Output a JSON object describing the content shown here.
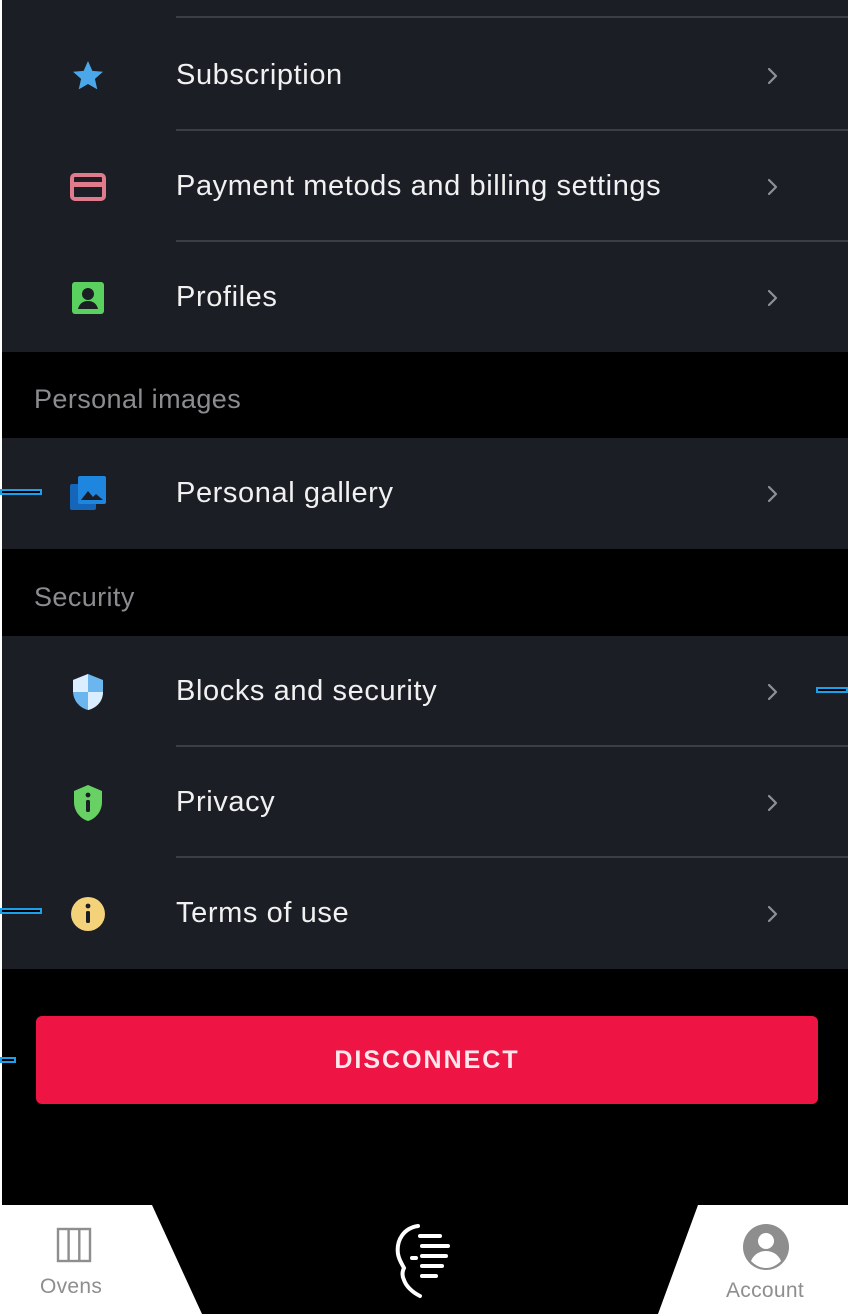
{
  "account_group": {
    "items": [
      {
        "label": "Subscription",
        "icon": "star-icon",
        "icon_color": "#4aa8ea"
      },
      {
        "label": "Payment metods and billing settings",
        "icon": "credit-card-icon",
        "icon_color": "#e07b8c"
      },
      {
        "label": "Profiles",
        "icon": "profile-badge-icon",
        "icon_color": "#5ad15f"
      }
    ]
  },
  "personal_images": {
    "header": "Personal images",
    "items": [
      {
        "label": "Personal gallery",
        "icon": "gallery-icon",
        "icon_color": "#1f86e0"
      }
    ]
  },
  "security": {
    "header": "Security",
    "items": [
      {
        "label": "Blocks and security",
        "icon": "shield-icon",
        "icon_color": "#6cb6ef"
      },
      {
        "label": "Privacy",
        "icon": "privacy-shield-icon",
        "icon_color": "#67d163"
      },
      {
        "label": "Terms of use",
        "icon": "info-icon",
        "icon_color": "#f3d27a"
      }
    ]
  },
  "disconnect_label": "DISCONNECT",
  "bottom_nav": {
    "ovens_label": "Ovens",
    "account_label": "Account"
  },
  "colors": {
    "background": "#000000",
    "row_background": "#1b1e25",
    "disconnect": "#ee1545",
    "callout": "#1aa0ec",
    "nav_label": "#8e8e8e"
  }
}
